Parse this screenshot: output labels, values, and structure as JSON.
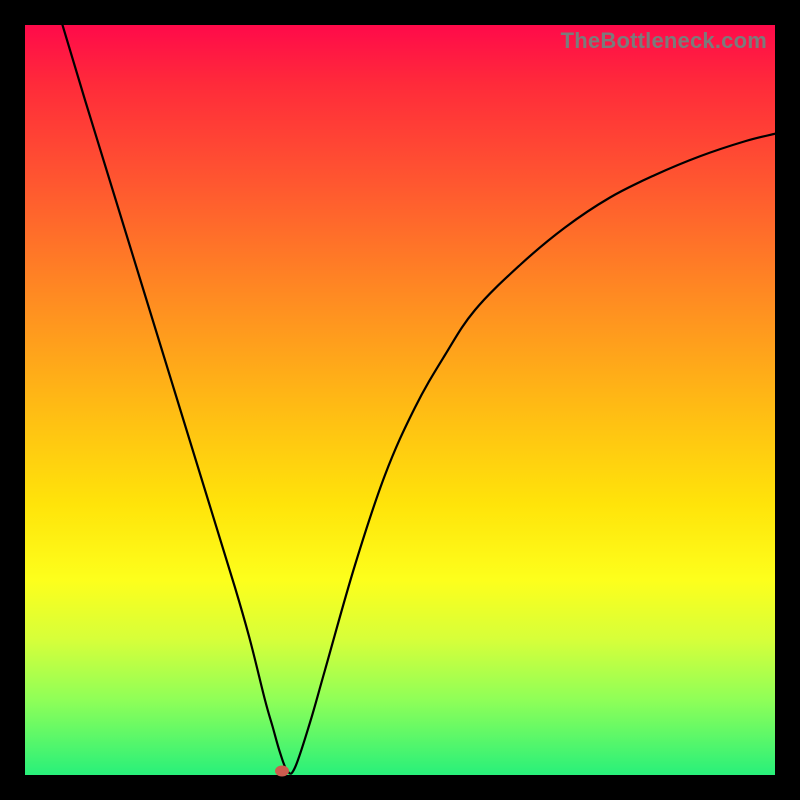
{
  "watermark": "TheBottleneck.com",
  "chart_data": {
    "type": "line",
    "title": "",
    "xlabel": "",
    "ylabel": "",
    "xlim": [
      0,
      100
    ],
    "ylim": [
      0,
      100
    ],
    "grid": false,
    "background_gradient": [
      "#ff0a4a",
      "#ffe40a",
      "#28f07a"
    ],
    "series": [
      {
        "name": "curve",
        "x": [
          5,
          8,
          12,
          16,
          20,
          24,
          28,
          30,
          32,
          33,
          34,
          35,
          36,
          38,
          40,
          44,
          48,
          52,
          56,
          60,
          66,
          72,
          78,
          84,
          90,
          96,
          100
        ],
        "y": [
          100,
          90,
          77,
          64,
          51,
          38,
          25,
          18,
          10,
          6.5,
          3,
          0.5,
          1,
          7,
          14,
          28,
          40,
          49,
          56,
          62,
          68,
          73,
          77,
          80,
          82.5,
          84.5,
          85.5
        ]
      }
    ],
    "marker": {
      "x": 34.2,
      "y": 0.6,
      "color": "#cc5b4e"
    }
  }
}
